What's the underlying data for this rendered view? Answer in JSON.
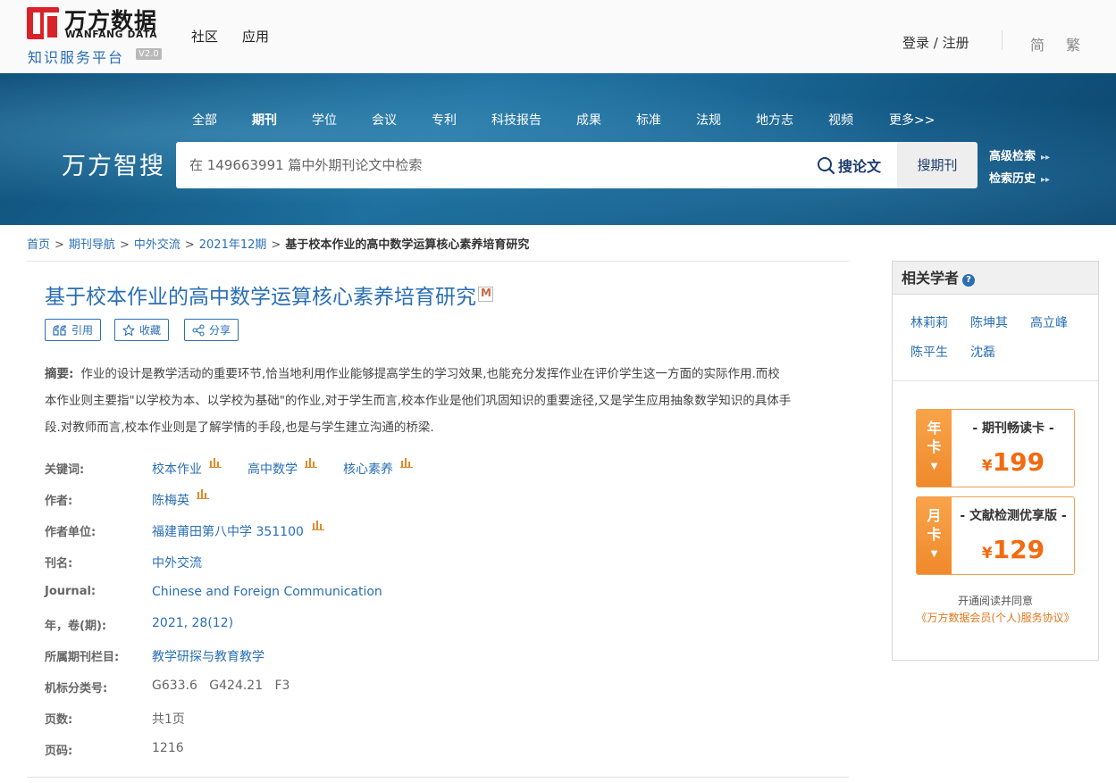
{
  "header": {
    "logo_cn": "万方数据",
    "logo_en": "WANFANG DATA",
    "logo_sub": "知识服务平台",
    "version": "V2.0",
    "nav": [
      "社区",
      "应用"
    ],
    "login": "登录 / 注册",
    "lang_simplified": "简",
    "lang_traditional": "繁"
  },
  "search": {
    "brand": "万方智搜",
    "categories": [
      "全部",
      "期刊",
      "学位",
      "会议",
      "专利",
      "科技报告",
      "成果",
      "标准",
      "法规",
      "地方志",
      "视频",
      "更多>>"
    ],
    "active_category": "期刊",
    "placeholder": "在 149663991 篇中外期刊论文中检索",
    "search_button": "搜论文",
    "journal_button": "搜期刊",
    "advanced": "高级检索",
    "history": "检索历史"
  },
  "breadcrumb": {
    "items": [
      "首页",
      "期刊导航",
      "中外交流",
      "2021年12期"
    ],
    "current": "基于校本作业的高中数学运算核心素养培育研究"
  },
  "article": {
    "title": "基于校本作业的高中数学运算核心素养培育研究",
    "actions": {
      "cite": "引用",
      "favorite": "收藏",
      "share": "分享"
    },
    "abstract_label": "摘要:",
    "abstract_lines": [
      "作业的设计是教学活动的重要环节,恰当地利用作业能够提高学生的学习效果,也能充分发挥作业在评价学生这一方面的实际作用.而校",
      "本作业则主要指\"以学校为本、以学校为基础\"的作业,对于学生而言,校本作业是他们巩固知识的重要途径,又是学生应用抽象数学知识的具体手",
      "段.对教师而言,校本作业则是了解学情的手段,也是与学生建立沟通的桥梁."
    ],
    "meta": {
      "keywords_label": "关键词:",
      "keywords": [
        "校本作业",
        "高中数学",
        "核心素养"
      ],
      "author_label": "作者:",
      "author": "陈梅英",
      "affiliation_label": "作者单位:",
      "affiliation": "福建莆田第八中学 351100",
      "journal_label": "刊名:",
      "journal": "中外交流",
      "journal_en_label": "Journal:",
      "journal_en": "Chinese and Foreign Communication",
      "volume_label": "年，卷(期):",
      "volume": "2021, 28(12)",
      "column_label": "所属期刊栏目:",
      "column": "教学研探与教育教学",
      "clc_label": "机标分类号:",
      "clc": "G633.6   G424.21   F3",
      "pages_label": "页数:",
      "pages": "共1页",
      "page_no_label": "页码:",
      "page_no": "1216"
    }
  },
  "sidebar": {
    "title": "相关学者",
    "help": "?",
    "scholars": [
      "林莉莉",
      "陈坤其",
      "高立峰",
      "陈平生",
      "沈磊"
    ],
    "cards": [
      {
        "tab": [
          "年",
          "卡"
        ],
        "name": "- 期刊畅读卡 -",
        "currency": "¥",
        "price": "199"
      },
      {
        "tab": [
          "月",
          "卡"
        ],
        "name": "- 文献检测优享版 -",
        "currency": "¥",
        "price": "129"
      }
    ],
    "agree_text": "开通阅读并同意",
    "agree_link": "《万方数据会员(个人)服务协议》"
  },
  "colors": {
    "link": "#2a6fb4",
    "brand_red": "#d9222a",
    "card_orange": "#f36a10"
  },
  "icons": [
    "search-icon",
    "quote-icon",
    "star-icon",
    "share-icon",
    "bar-chart-icon",
    "help-icon",
    "double-arrow-icon",
    "down-arrow-icon"
  ]
}
